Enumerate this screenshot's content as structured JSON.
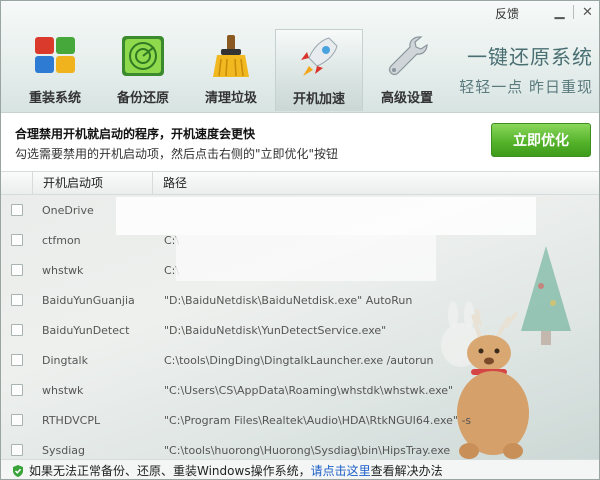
{
  "window": {
    "feedback_label": "反馈",
    "minimize_glyph": "▁",
    "close_glyph": "✕"
  },
  "nav": {
    "items": [
      {
        "label": "重装系统",
        "icon": "windows-blocks-icon"
      },
      {
        "label": "备份还原",
        "icon": "radar-icon"
      },
      {
        "label": "清理垃圾",
        "icon": "broom-icon"
      },
      {
        "label": "开机加速",
        "icon": "rocket-icon",
        "active": true
      },
      {
        "label": "高级设置",
        "icon": "wrench-icon"
      }
    ]
  },
  "brand": {
    "title": "一键还原系统",
    "subtitle": "轻轻一点  昨日重现"
  },
  "notice": {
    "headline": "合理禁用开机就启动的程序，开机速度会更快",
    "subtext": "勾选需要禁用的开机启动项，然后点击右侧的\"立即优化\"按钮",
    "optimize_button": "立即优化"
  },
  "table": {
    "columns": [
      "开机启动项",
      "路径"
    ],
    "rows": [
      {
        "name": "OneDrive",
        "path": ""
      },
      {
        "name": "ctfmon",
        "path": "C:\\"
      },
      {
        "name": "whstwk",
        "path": "C:\\"
      },
      {
        "name": "BaiduYunGuanjia",
        "path": "\"D:\\BaiduNetdisk\\BaiduNetdisk.exe\" AutoRun"
      },
      {
        "name": "BaiduYunDetect",
        "path": "\"D:\\BaiduNetdisk\\YunDetectService.exe\""
      },
      {
        "name": "Dingtalk",
        "path": "C:\\tools\\DingDing\\DingtalkLauncher.exe /autorun"
      },
      {
        "name": "whstwk",
        "path": "\"C:\\Users\\CS\\AppData\\Roaming\\whstdk\\whstwk.exe\""
      },
      {
        "name": "RTHDVCPL",
        "path": "\"C:\\Program Files\\Realtek\\Audio\\HDA\\RtkNGUI64.exe\" -s"
      },
      {
        "name": "Sysdiag",
        "path": "\"C:\\tools\\huorong\\Huorong\\Sysdiag\\bin\\HipsTray.exe"
      }
    ]
  },
  "footer": {
    "text_before": "如果无法正常备份、还原、重装Windows操作系统，",
    "link_text": "请点击这里",
    "text_after": "查看解决办法"
  },
  "colors": {
    "accent_green": "#52b128",
    "link_blue": "#1d5fc9",
    "brand_teal": "#4a6f73"
  }
}
